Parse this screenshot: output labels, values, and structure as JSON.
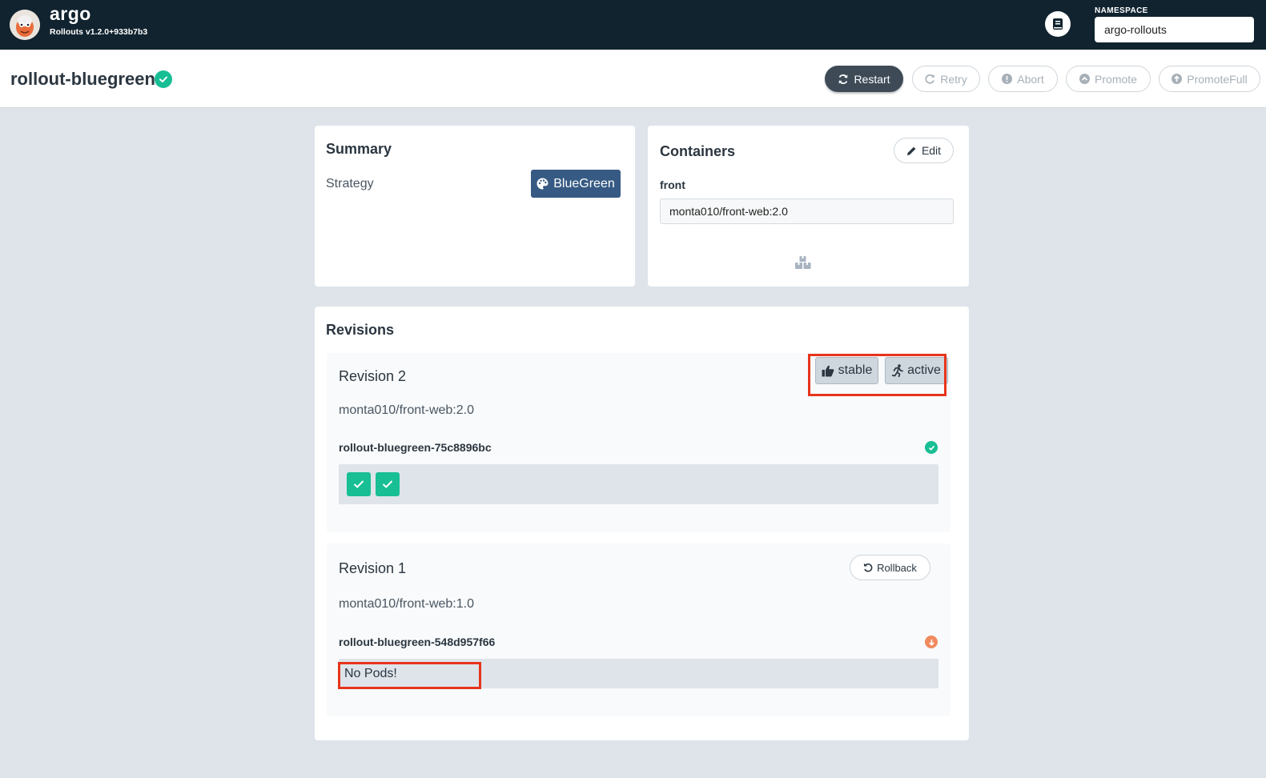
{
  "app": {
    "brand_name": "argo",
    "version": "Rollouts v1.2.0+933b7b3",
    "namespace_label": "NAMESPACE",
    "namespace_value": "argo-rollouts"
  },
  "header": {
    "rollout_name": "rollout-bluegreen",
    "status": "healthy",
    "actions": {
      "restart": "Restart",
      "retry": "Retry",
      "abort": "Abort",
      "promote": "Promote",
      "promote_full": "PromoteFull"
    }
  },
  "summary": {
    "title": "Summary",
    "strategy_label": "Strategy",
    "strategy_value": "BlueGreen"
  },
  "containers": {
    "title": "Containers",
    "edit_label": "Edit",
    "items": [
      {
        "name": "front",
        "image": "monta010/front-web:2.0"
      }
    ]
  },
  "revisions": {
    "title": "Revisions",
    "items": [
      {
        "title": "Revision 2",
        "image": "monta010/front-web:2.0",
        "tags": [
          "stable",
          "active"
        ],
        "replicaset": "rollout-bluegreen-75c8896bc",
        "replicaset_status": "healthy",
        "pods": [
          "running",
          "running"
        ]
      },
      {
        "title": "Revision 1",
        "image": "monta010/front-web:1.0",
        "rollback_label": "Rollback",
        "replicaset": "rollout-bluegreen-548d957f66",
        "replicaset_status": "scaled-down",
        "pods_empty_text": "No Pods!"
      }
    ]
  },
  "colors": {
    "topbar": "#10232f",
    "success": "#18be94",
    "warning": "#f08a5d",
    "strategy_badge": "#365a83",
    "highlight": "#e8341c"
  }
}
